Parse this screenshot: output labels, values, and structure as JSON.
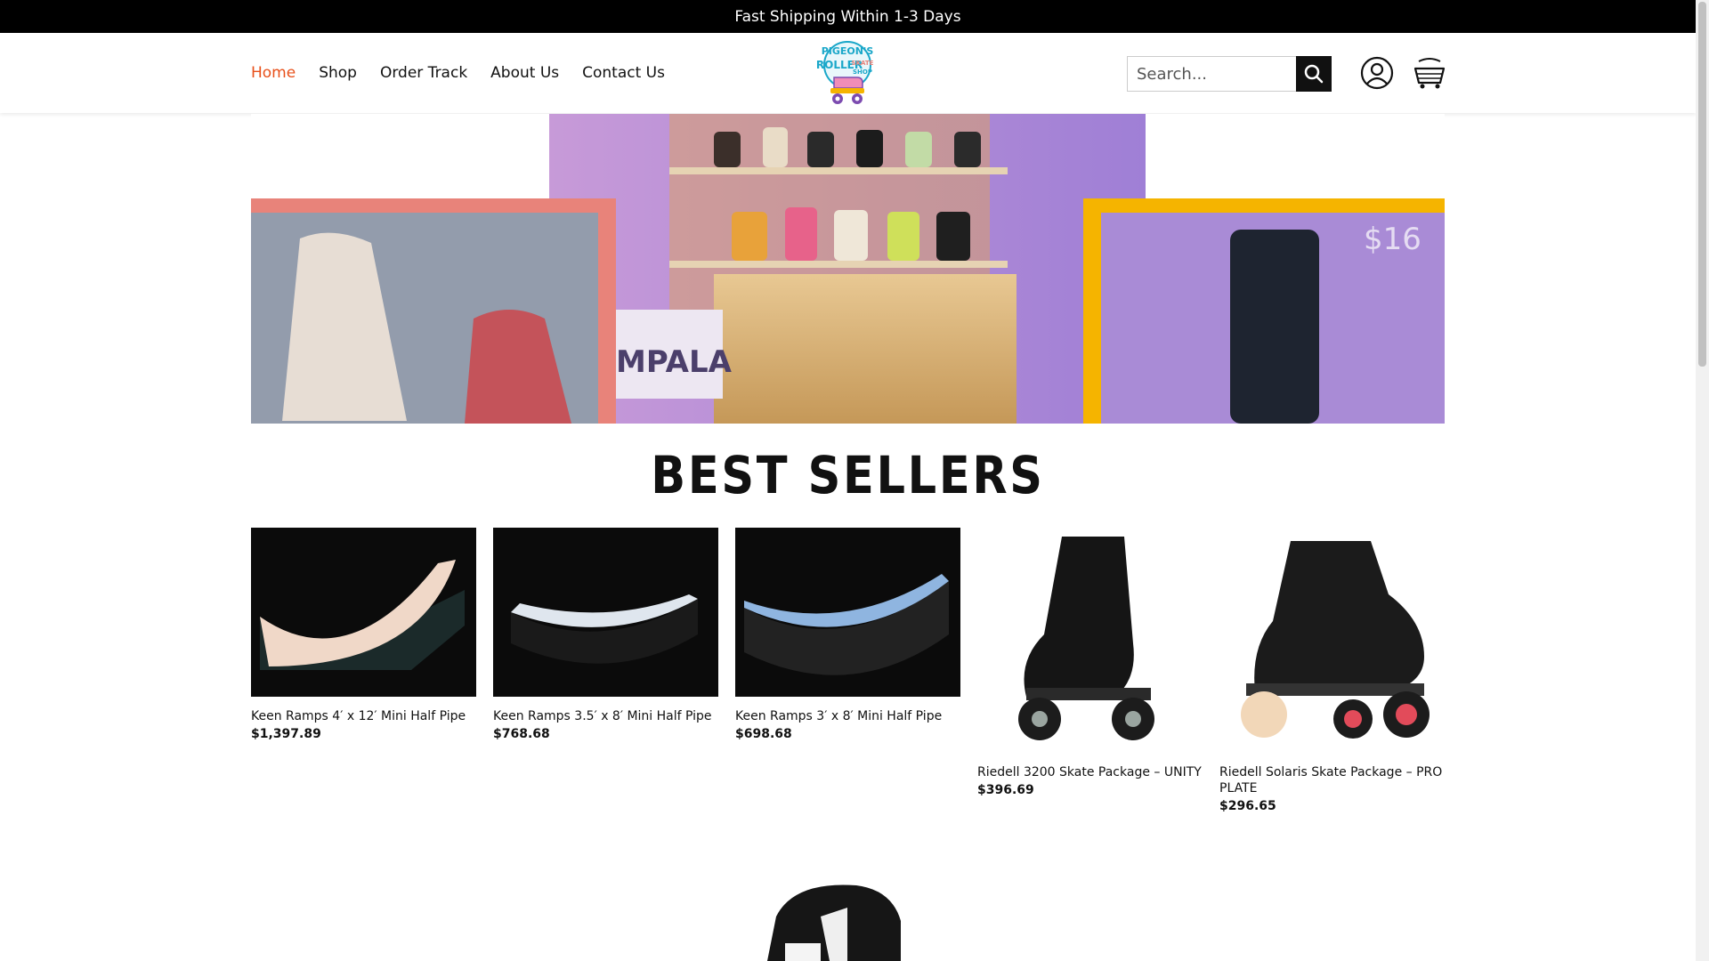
{
  "announcement": "Fast Shipping Within 1-3 Days",
  "nav": {
    "items": [
      "Home",
      "Shop",
      "Order Track",
      "About Us",
      "Contact Us"
    ],
    "active": "Home"
  },
  "logo_text": "PIGEON'S ROLLER SKATE SHOP",
  "search": {
    "placeholder": "Search..."
  },
  "icons": {
    "search": "search-icon",
    "account": "user-icon",
    "cart": "cart-icon"
  },
  "colors": {
    "accent": "#e8501a",
    "topbar": "#000000",
    "hero_pink": "#e8837a",
    "hero_orange": "#f5b400",
    "hero_purple": "#b085d4"
  },
  "section_title": "BEST SELLERS",
  "products": [
    {
      "name": "Keen Ramps 4′ x 12′ Mini Half Pipe",
      "price": "$1,397.89"
    },
    {
      "name": "Keen Ramps 3.5′ x 8′ Mini Half Pipe",
      "price": "$768.68"
    },
    {
      "name": "Keen Ramps 3′ x 8′ Mini Half Pipe",
      "price": "$698.68"
    },
    {
      "name": "Riedell 3200 Skate Package – UNITY",
      "price": "$396.69"
    },
    {
      "name": "Riedell Solaris Skate Package – PRO PLATE",
      "price": "$296.65"
    }
  ]
}
